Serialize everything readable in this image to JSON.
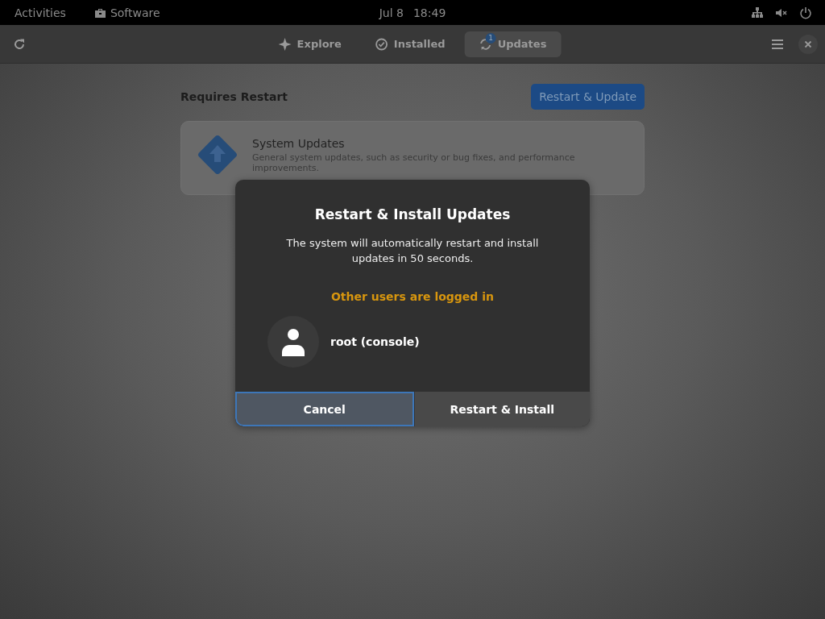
{
  "top_bar": {
    "activities": "Activities",
    "app_name": "Software",
    "date": "Jul 8",
    "time": "18:49"
  },
  "tabs": [
    {
      "kind": "explore",
      "label": "Explore",
      "selected": false
    },
    {
      "kind": "installed",
      "label": "Installed",
      "selected": false
    },
    {
      "kind": "updates",
      "label": "Updates",
      "selected": true,
      "badge": "1"
    }
  ],
  "section": {
    "title": "Requires Restart",
    "action": "Restart & Update"
  },
  "update_item": {
    "title": "System Updates",
    "description": "General system updates, such as security or bug fixes, and performance improvements."
  },
  "dialog": {
    "title": "Restart & Install Updates",
    "message": "The system will automatically restart and install updates in 50 seconds.",
    "warning": "Other users are logged in",
    "users": [
      {
        "name": "root (console)"
      }
    ],
    "buttons": [
      {
        "label": "Cancel",
        "focused": true
      },
      {
        "label": "Restart & Install",
        "focused": false
      }
    ]
  }
}
